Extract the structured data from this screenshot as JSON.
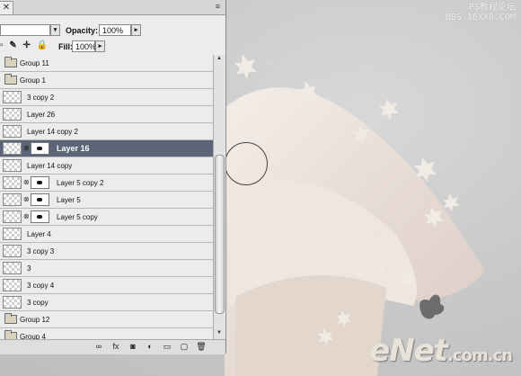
{
  "watermark": {
    "line1": "PS教程论坛",
    "line2": "BBS.16XX8.COM"
  },
  "logo": {
    "brand": "eNet",
    "suffix": ".com.cn"
  },
  "panel": {
    "close_glyph": "✕",
    "menu_glyph": "≡",
    "opacity_label": "Opacity:",
    "opacity_value": "100%",
    "fill_label": "Fill:",
    "fill_value": "100%",
    "lock_icons": "▫ ✎ ✛ 🔒"
  },
  "layers": [
    {
      "name": "Group 11",
      "kind": "group"
    },
    {
      "name": "Group 1",
      "kind": "group"
    },
    {
      "name": "3 copy 2",
      "kind": "image"
    },
    {
      "name": "Layer 26",
      "kind": "image"
    },
    {
      "name": "Layer 14 copy 2",
      "kind": "image"
    },
    {
      "name": "Layer 16",
      "kind": "masked",
      "selected": true
    },
    {
      "name": "Layer 14 copy",
      "kind": "image"
    },
    {
      "name": "Layer 5 copy 2",
      "kind": "masked"
    },
    {
      "name": "Layer 5",
      "kind": "masked"
    },
    {
      "name": "Layer 5 copy",
      "kind": "masked"
    },
    {
      "name": "Layer 4",
      "kind": "image"
    },
    {
      "name": "3 copy 3",
      "kind": "image"
    },
    {
      "name": "3",
      "kind": "image"
    },
    {
      "name": "3 copy 4",
      "kind": "image"
    },
    {
      "name": "3 copy",
      "kind": "image"
    },
    {
      "name": "Group 12",
      "kind": "group"
    },
    {
      "name": "Group 4",
      "kind": "group"
    }
  ],
  "bottom_icons": [
    {
      "name": "link-layers-icon",
      "glyph": "∞"
    },
    {
      "name": "layer-style-icon",
      "glyph": "fx"
    },
    {
      "name": "add-mask-icon",
      "glyph": "◙"
    },
    {
      "name": "adjustment-layer-icon",
      "glyph": "◐"
    },
    {
      "name": "new-group-icon",
      "glyph": "▭"
    },
    {
      "name": "new-layer-icon",
      "glyph": "▢"
    },
    {
      "name": "delete-layer-icon",
      "glyph": "🗑"
    }
  ]
}
